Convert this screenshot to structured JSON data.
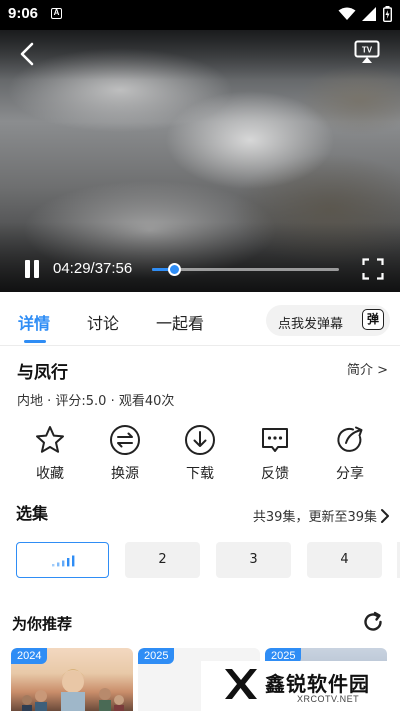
{
  "status_bar": {
    "time": "9:06",
    "notification_glyph": "A"
  },
  "player": {
    "current_time": "04:29",
    "duration": "37:56",
    "time_display": "04:29/37:56",
    "progress": 0.118,
    "accent": "#2f8df5"
  },
  "tabs": [
    {
      "label": "详情",
      "active": true
    },
    {
      "label": "讨论",
      "active": false
    },
    {
      "label": "一起看",
      "active": false
    }
  ],
  "danmu": {
    "label": "点我发弹幕",
    "icon_text": "弹"
  },
  "show": {
    "title": "与凤行",
    "intro_link": "简介 >",
    "meta": "内地 · 评分:5.0 · 观看40次"
  },
  "actions": [
    {
      "label": "收藏",
      "icon": "star-icon"
    },
    {
      "label": "换源",
      "icon": "swap-icon"
    },
    {
      "label": "下载",
      "icon": "download-icon"
    },
    {
      "label": "反馈",
      "icon": "feedback-icon"
    },
    {
      "label": "分享",
      "icon": "share-icon"
    }
  ],
  "episodes": {
    "title": "选集",
    "info": "共39集，更新至39集",
    "items": [
      "",
      "2",
      "3",
      "4"
    ],
    "playing_index": 0
  },
  "recommend": {
    "title": "为你推荐",
    "cards": [
      {
        "year": "2024"
      },
      {
        "year": "2025"
      },
      {
        "year": "2025"
      }
    ]
  },
  "watermark": {
    "name": "鑫锐软件园",
    "url": "XRCOTV.NET"
  }
}
